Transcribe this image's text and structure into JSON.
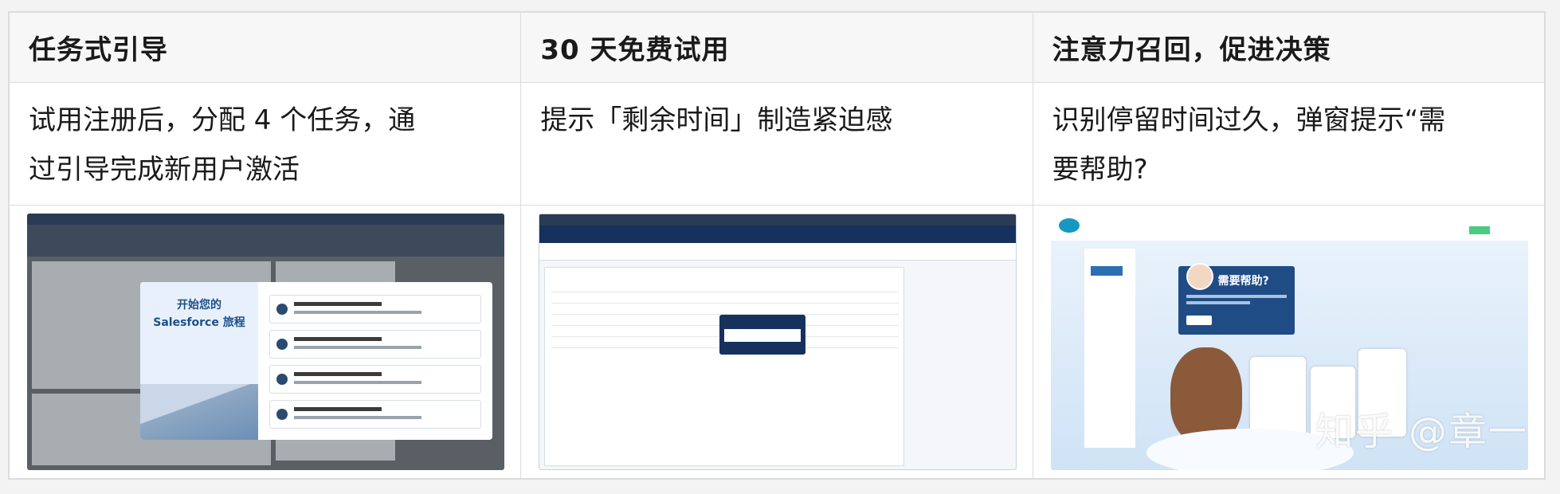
{
  "headers": [
    "任务式引导",
    "30 天免费试用",
    "注意力召回，促进决策"
  ],
  "descriptions": {
    "col1": [
      "试用注册后，分配 4 个任务，通",
      "过引导完成新用户激活"
    ],
    "col2": [
      "提示「剩余时间」制造紧迫感"
    ],
    "col3": [
      "识别停留时间过久，弹窗提示“需",
      "要帮助?"
    ]
  },
  "shot1": {
    "modal_title_line1": "开始您的",
    "modal_title_line2": "Salesforce 旅程"
  },
  "shot3": {
    "dialog_title": "需要帮助?"
  },
  "watermark": "知乎 @章一"
}
